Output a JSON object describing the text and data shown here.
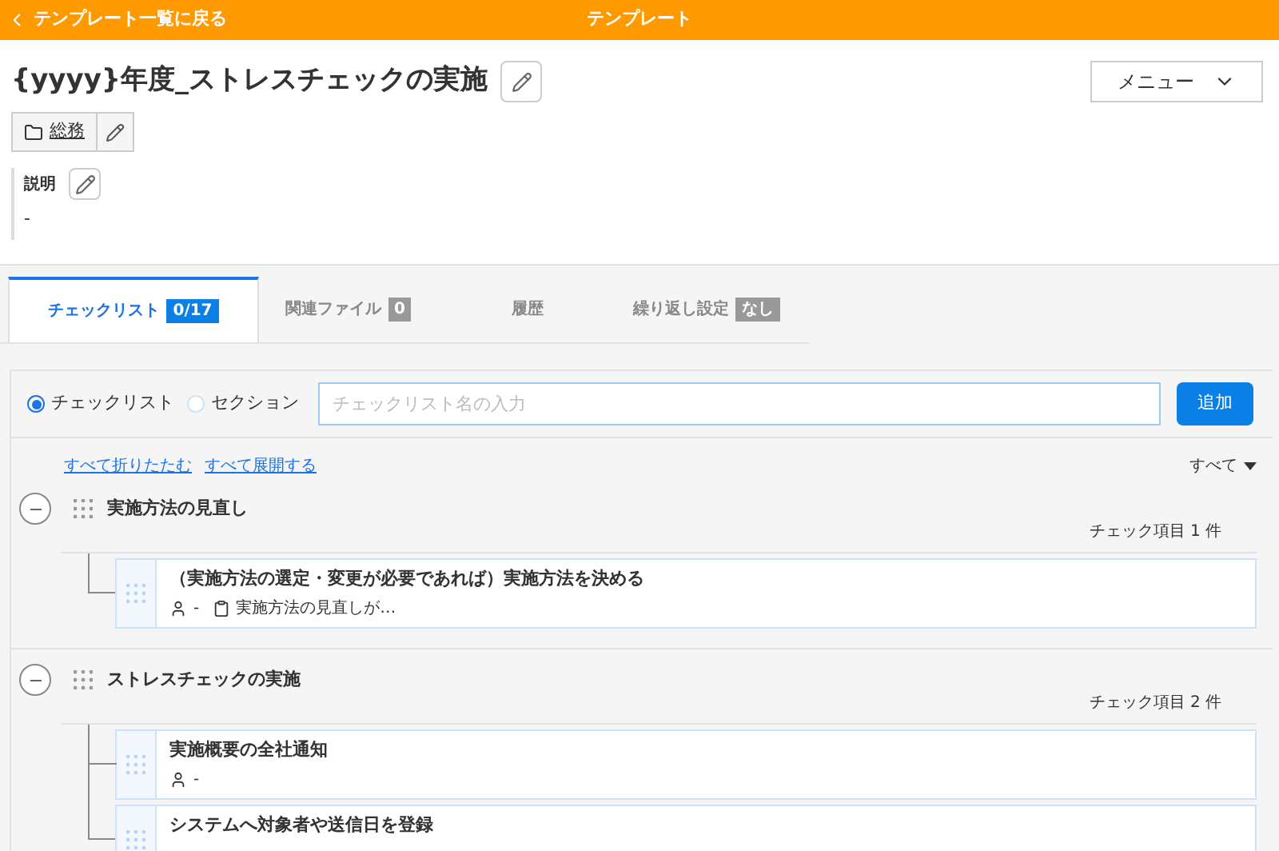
{
  "top_bar": {
    "back_link": "テンプレート一覧に戻る",
    "title": "テンプレート"
  },
  "page": {
    "title": "{yyyy}年度_ストレスチェックの実施",
    "menu_button": "メニュー",
    "category": "総務",
    "description_label": "説明",
    "description": "-"
  },
  "tabs": [
    {
      "label": "チェックリスト",
      "badge": "0/17",
      "selected": true
    },
    {
      "label": "関連ファイル",
      "badge": "0",
      "selected": false
    },
    {
      "label": "履歴",
      "selected": false
    },
    {
      "label": "繰り返し設定",
      "badge": "なし",
      "selected": false
    }
  ],
  "add_form": {
    "options": [
      {
        "label": "チェックリスト",
        "selected": true
      },
      {
        "label": "セクション",
        "selected": false
      }
    ],
    "placeholder": "チェックリスト名の入力",
    "add_button": "追加"
  },
  "actions": {
    "collapse_all": "すべて折りたたむ",
    "expand_all": "すべて展開する",
    "filter": "すべて"
  },
  "sections": [
    {
      "title": "実施方法の見直し",
      "expanded": true,
      "count": "チェック項目 1 件",
      "items": [
        {
          "title": "（実施方法の選定・変更が必要であれば）実施方法を決める",
          "assignee": "-",
          "note": "実施方法の見直しが…"
        }
      ]
    },
    {
      "title": "ストレスチェックの実施",
      "expanded": true,
      "count": "チェック項目 2 件",
      "items": [
        {
          "title": "実施概要の全社通知",
          "assignee": "-"
        },
        {
          "title": "システムへ対象者や送信日を登録"
        }
      ]
    }
  ]
}
